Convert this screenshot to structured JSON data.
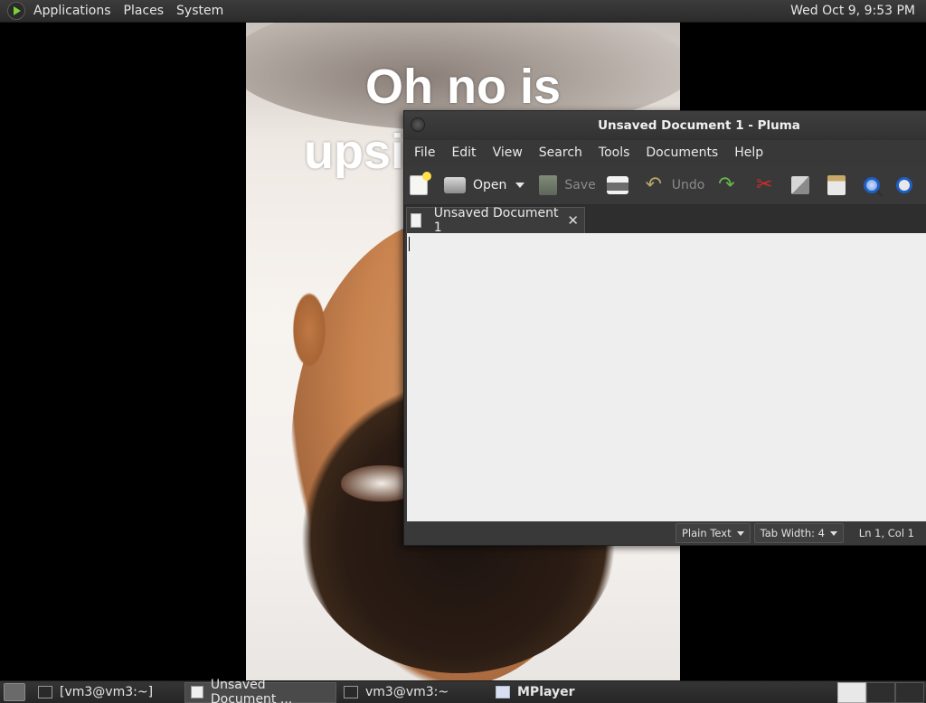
{
  "top_panel": {
    "menus": [
      "Applications",
      "Places",
      "System"
    ],
    "clock": "Wed Oct  9,  9:53 PM"
  },
  "video": {
    "caption_line1": "Oh no is",
    "caption_line2": "upsi"
  },
  "pluma": {
    "title": "Unsaved Document 1 - Pluma",
    "menu": [
      "File",
      "Edit",
      "View",
      "Search",
      "Tools",
      "Documents",
      "Help"
    ],
    "toolbar": {
      "open_label": "Open",
      "save_label": "Save",
      "undo_label": "Undo"
    },
    "tab": {
      "label": "Unsaved Document 1",
      "close": "✕"
    },
    "statusbar": {
      "language": "Plain Text",
      "tab_width": "Tab Width:  4",
      "position": "Ln 1, Col 1"
    }
  },
  "taskbar": {
    "tasks": [
      {
        "label": "[vm3@vm3:~]",
        "icon": "terminal-icon"
      },
      {
        "label": "Unsaved Document ...",
        "icon": "text-editor-icon",
        "active": true
      },
      {
        "label": "vm3@vm3:~",
        "icon": "terminal-icon"
      },
      {
        "label": "MPlayer",
        "icon": "mplayer-icon"
      }
    ]
  }
}
